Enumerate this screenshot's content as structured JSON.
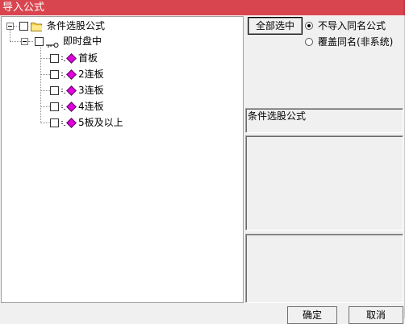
{
  "window": {
    "title": "导入公式"
  },
  "tree": {
    "root": {
      "label": "条件选股公式",
      "icon": "folder-icon"
    },
    "group": {
      "label": "即时盘中",
      "icon": "key-icon"
    },
    "items": [
      {
        "label": "首板",
        "icon": "formula-icon"
      },
      {
        "label": "2连板",
        "icon": "formula-icon"
      },
      {
        "label": "3连板",
        "icon": "formula-icon"
      },
      {
        "label": "4连板",
        "icon": "formula-icon"
      },
      {
        "label": "5板及以上",
        "icon": "formula-icon"
      }
    ]
  },
  "actions": {
    "select_all_label": "全部选中",
    "ok_label": "确定",
    "cancel_label": "取消"
  },
  "import_options": {
    "no_import_same_name": "不导入同名公式",
    "overwrite_same_name": "覆盖同名(非系统)",
    "selected": "no_import_same_name"
  },
  "info": {
    "category_label": "条件选股公式"
  },
  "colors": {
    "titlebar": "#d9454f",
    "diamond": "#e000e0"
  }
}
